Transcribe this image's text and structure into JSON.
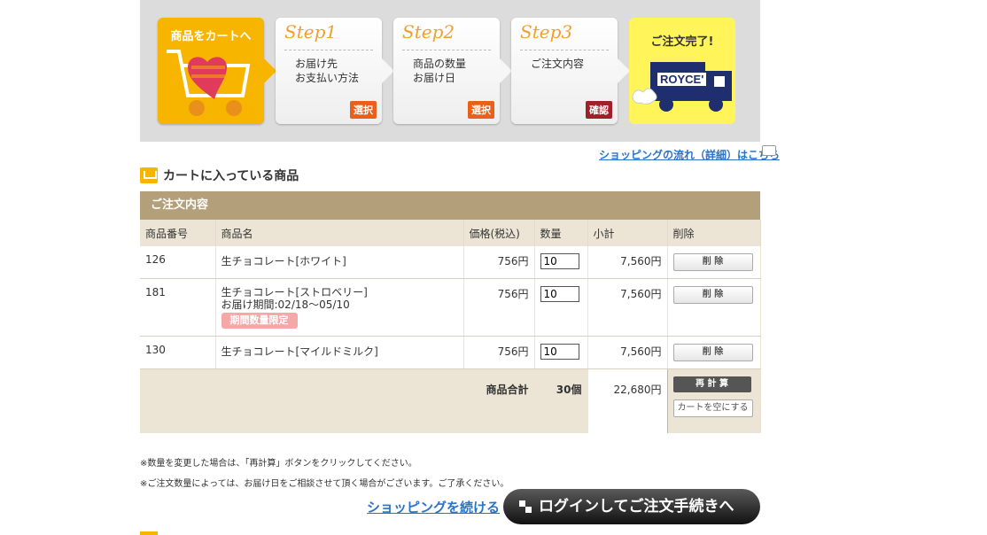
{
  "banner": {
    "cart_label": "商品をカートへ",
    "steps": [
      {
        "title": "Step1",
        "desc": "お届け先\nお支払い方法",
        "badge": "選択"
      },
      {
        "title": "Step2",
        "desc": "商品の数量\nお届け日",
        "badge": "選択"
      },
      {
        "title": "Step3",
        "desc": "ご注文内容",
        "badge": "確認"
      }
    ],
    "done_label": "ご注文完了!",
    "brand": "ROYCE'"
  },
  "flow_link": "ショッピングの流れ（詳細）はこちら",
  "section_title": "カートに入っている商品",
  "order": {
    "header": "ご注文内容",
    "columns": [
      "商品番号",
      "商品名",
      "価格(税込)",
      "数量",
      "小計",
      "削除"
    ],
    "rows": [
      {
        "id": "126",
        "name": "生チョコレート[ホワイト]",
        "price": "756円",
        "qty": "10",
        "subtotal": "7,560円",
        "delete": "削 除"
      },
      {
        "id": "181",
        "name": "生チョコレート[ストロベリー]",
        "period": "お届け期間:02/18〜05/10",
        "badge": "期間数量限定",
        "price": "756円",
        "qty": "10",
        "subtotal": "7,560円",
        "delete": "削 除"
      },
      {
        "id": "130",
        "name": "生チョコレート[マイルドミルク]",
        "price": "756円",
        "qty": "10",
        "subtotal": "7,560円",
        "delete": "削 除"
      }
    ],
    "summary": {
      "label": "商品合計",
      "count": "30個",
      "total": "22,680円",
      "recalc": "再 計 算",
      "empty": "カートを空にする"
    }
  },
  "notes": [
    "※数量を変更した場合は、「再計算」ボタンをクリックしてください。",
    "※ご注文数量によっては、お届け日をご相談させて頂く場合がございます。ご了承ください。"
  ],
  "continue_label": "ショッピングを続ける",
  "login_label": "ログインしてご注文手続きへ",
  "colors": {
    "accent": "#f7b500",
    "header": "#b3a07a",
    "link": "#2a73c8"
  }
}
